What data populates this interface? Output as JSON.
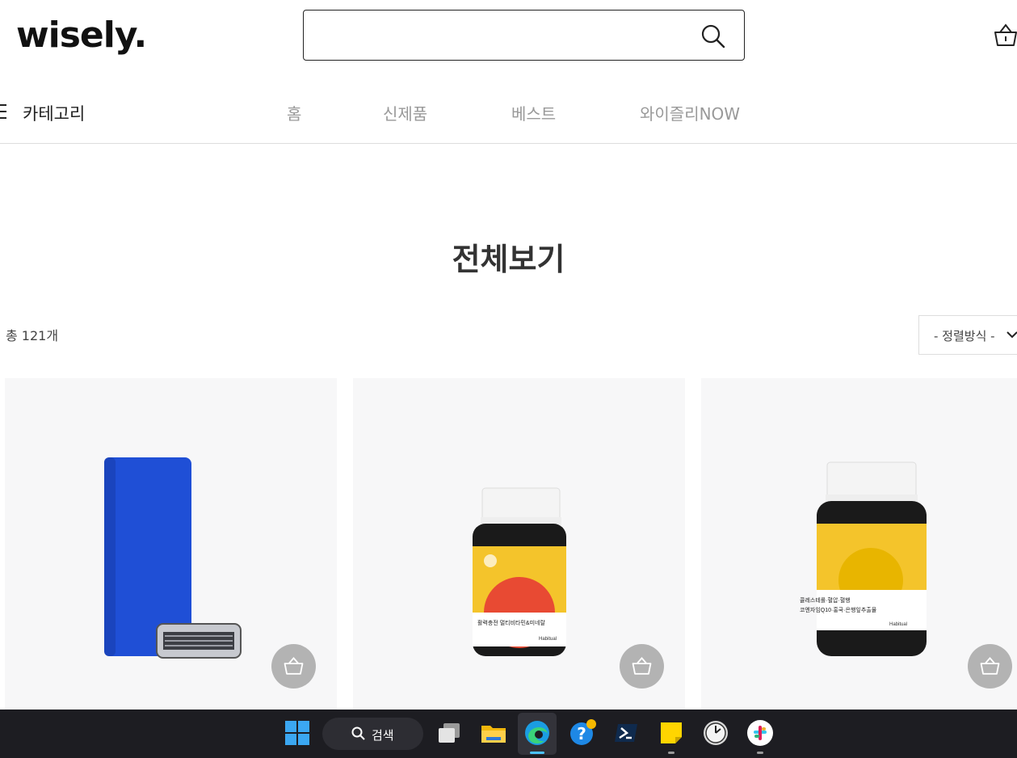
{
  "header": {
    "logo": "wisely.",
    "search_value": "",
    "search_icon": "search-icon",
    "cart_icon": "basket-icon"
  },
  "nav": {
    "category_label": "카테고리",
    "items": [
      "홈",
      "신제품",
      "베스트",
      "와이즐리NOW"
    ]
  },
  "main": {
    "title": "전체보기",
    "count_text": "총 121개",
    "sort_label": "- 정렬방식 -"
  },
  "products": [
    {
      "image": "razor-holder-with-cartridge",
      "cart_icon": "basket-icon"
    },
    {
      "image": "multivitamin-bottle",
      "label_text": "활력충전 멀티비타민&미네랄",
      "brand": "Habitual",
      "cart_icon": "basket-icon"
    },
    {
      "image": "coq10-supplement-bottle",
      "label_text": "콜레스테롤·혈압·혈행",
      "label_text2": "코엔자임Q10·홍국·은행잎추출물",
      "brand": "Habitual",
      "cart_icon": "basket-icon"
    }
  ],
  "taskbar": {
    "search_label": "검색",
    "apps": [
      "windows-start-icon",
      "task-view-icon",
      "file-explorer-icon",
      "edge-browser-icon",
      "help-icon",
      "terminal-icon",
      "sticky-notes-icon",
      "clock-icon",
      "slack-icon"
    ]
  },
  "colors": {
    "razor_blue": "#1f4fd6",
    "bottle_yellow": "#f4c42b",
    "bottle_red": "#e84a33",
    "taskbar": "#1d1d22"
  }
}
